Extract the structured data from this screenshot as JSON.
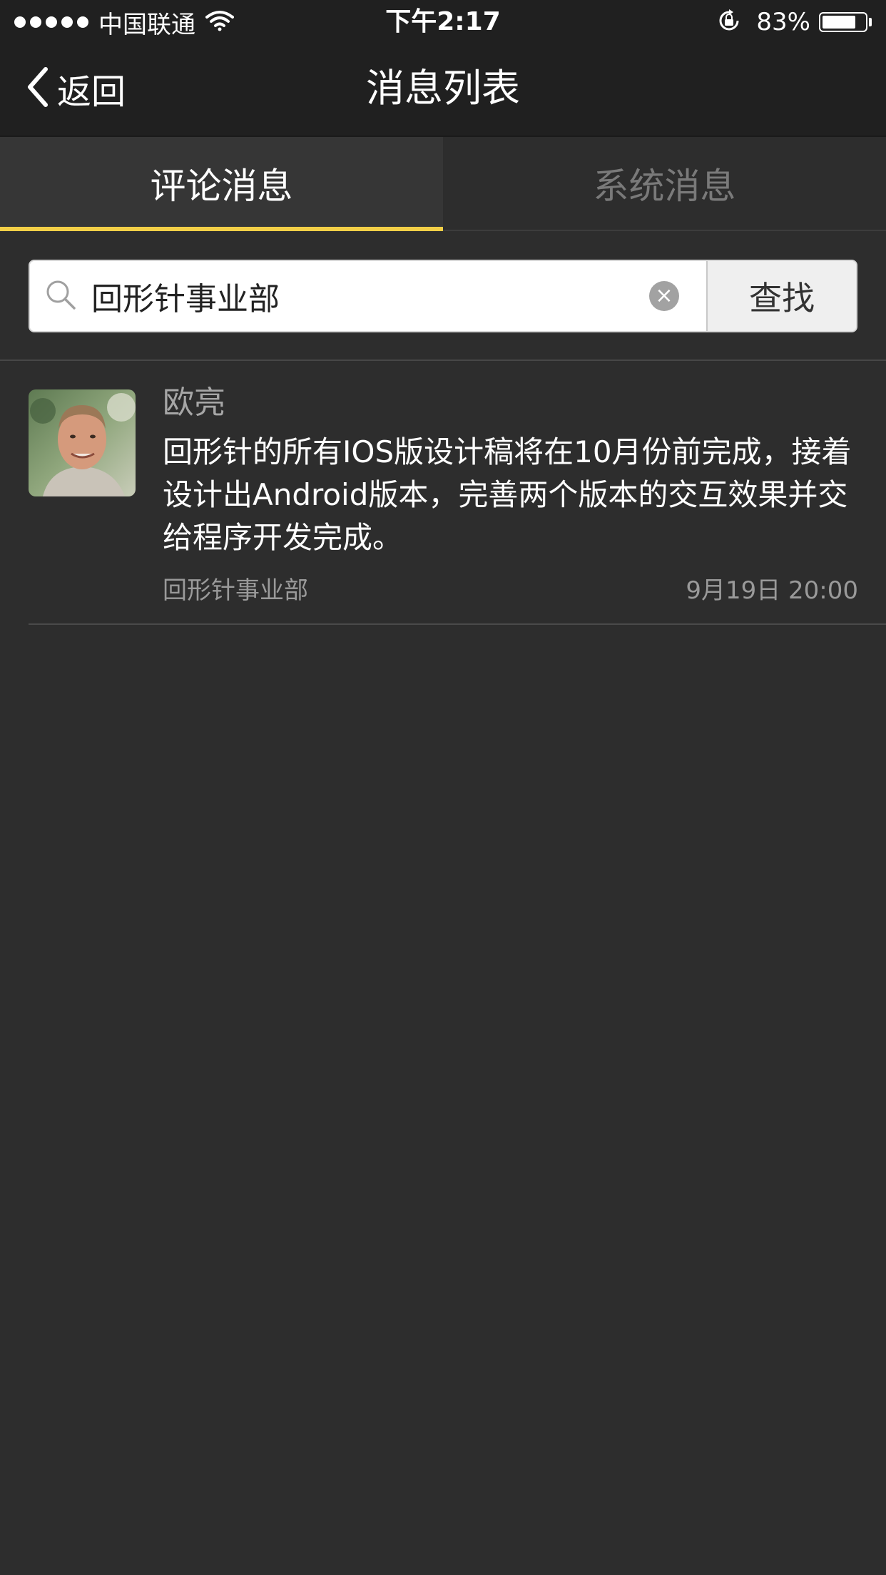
{
  "status_bar": {
    "carrier": "中国联通",
    "time": "下午2:17",
    "battery_percent": "83%",
    "battery_level": 0.83,
    "icons": [
      "signal-dots",
      "wifi-icon",
      "orientation-lock-icon",
      "battery-icon"
    ]
  },
  "nav": {
    "back_label": "返回",
    "title": "消息列表"
  },
  "tabs": [
    {
      "label": "评论消息",
      "active": true
    },
    {
      "label": "系统消息",
      "active": false
    }
  ],
  "search": {
    "value": "回形针事业部",
    "clear_icon": "×",
    "button_label": "查找"
  },
  "messages": [
    {
      "author": "欧亮",
      "text": "回形针的所有IOS版设计稿将在10月份前完成，接着设计出Android版本，完善两个版本的交互效果并交给程序开发完成。",
      "group": "回形针事业部",
      "timestamp": "9月19日  20:00"
    }
  ],
  "colors": {
    "background": "#2d2d2d",
    "bar_background": "#202020",
    "tab_active_bg": "#363636",
    "accent": "#f3cf47",
    "muted_text": "#9a9a9a"
  }
}
